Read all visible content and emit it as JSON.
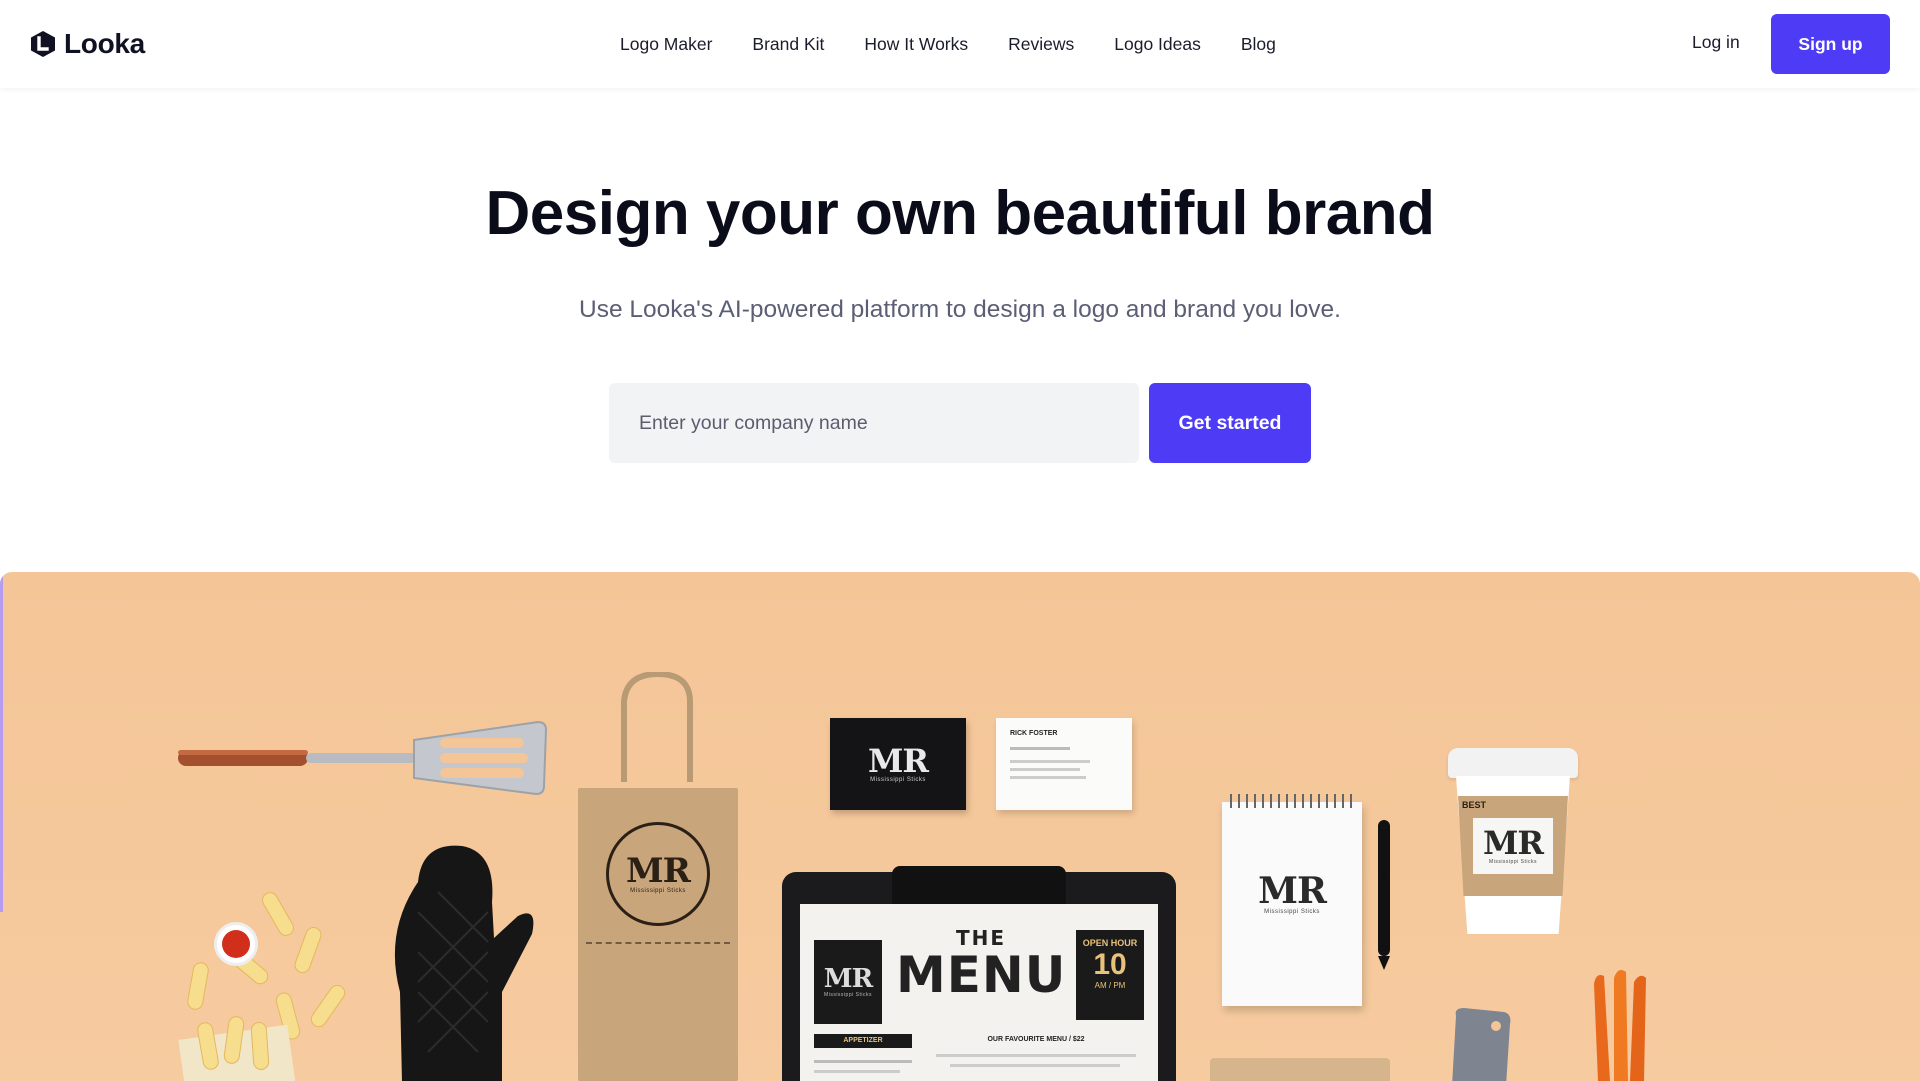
{
  "brand": {
    "name": "Looka"
  },
  "nav": {
    "items": [
      "Logo Maker",
      "Brand Kit",
      "How It Works",
      "Reviews",
      "Logo Ideas",
      "Blog"
    ]
  },
  "auth": {
    "login": "Log in",
    "signup": "Sign up"
  },
  "hero": {
    "title": "Design your own beautiful brand",
    "subtitle": "Use Looka's AI-powered platform to design a logo and brand you love.",
    "input_placeholder": "Enter your company name",
    "cta": "Get started"
  },
  "showcase": {
    "logo_mark": "MR",
    "logo_tagline": "Mississippi Sticks",
    "business_card_name": "RICK FOSTER",
    "menu_title_top": "THE",
    "menu_title": "MENU",
    "open_hour_label": "OPEN HOUR",
    "open_hour_value": "10",
    "open_hour_unit": "AM / PM",
    "menu_section_1": "APPETIZER",
    "menu_section_2": "OUR FAVOURITE MENU / $22",
    "cup_label": "BEST"
  },
  "colors": {
    "accent": "#4e3bf5",
    "showcase_background": "#f5c89b",
    "title": "#0b0c1a",
    "subtitle": "#5b5f75"
  }
}
